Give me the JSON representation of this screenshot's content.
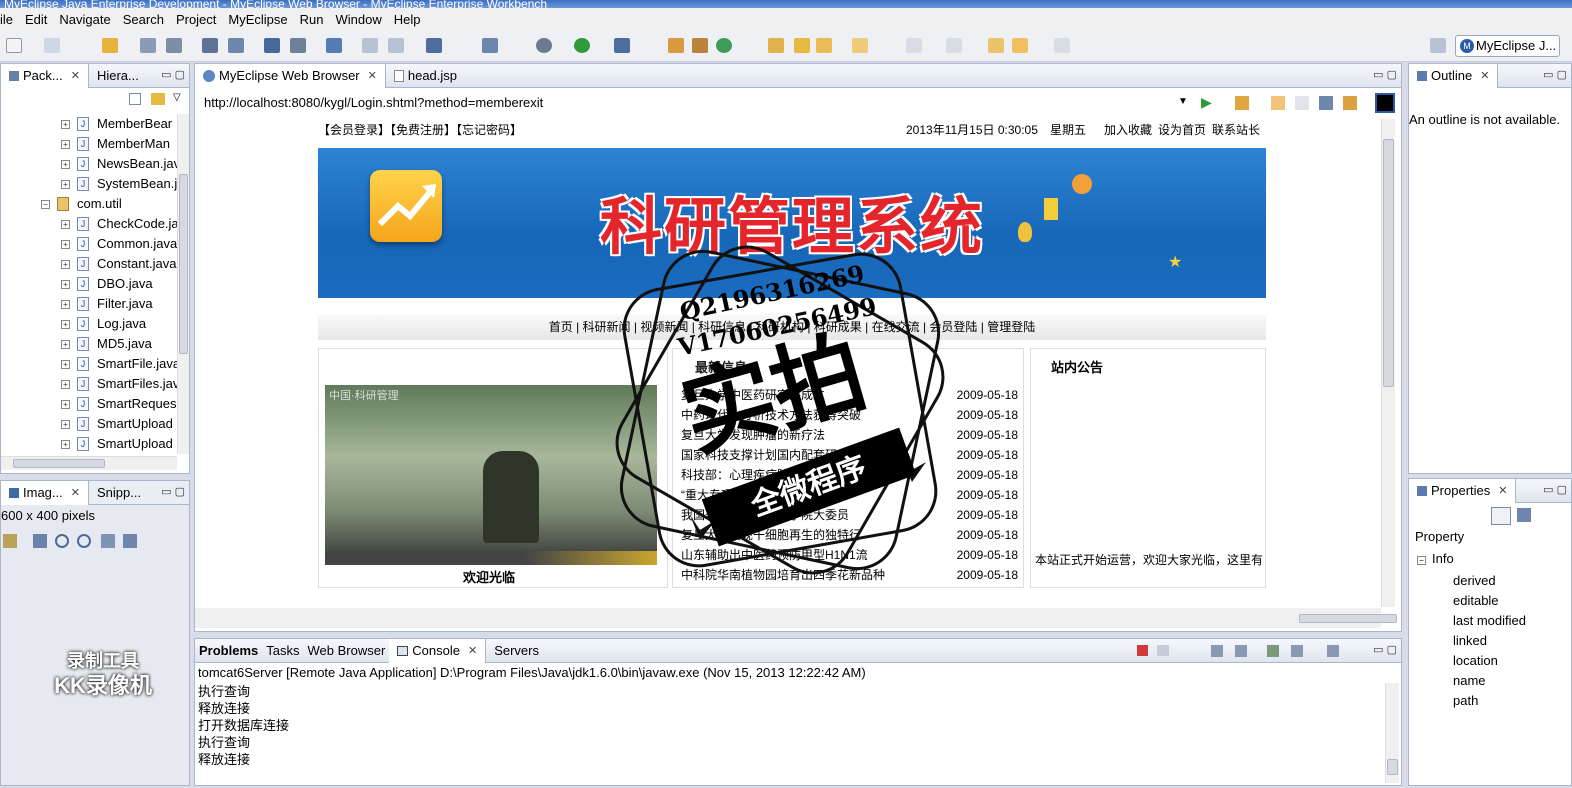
{
  "window": {
    "title": "MyEclipse Java Enterprise Development - MyEclipse Web Browser - MyEclipse Enterprise Workbench"
  },
  "menu": [
    "ile",
    "Edit",
    "Navigate",
    "Search",
    "Project",
    "MyEclipse",
    "Run",
    "Window",
    "Help"
  ],
  "perspective": "MyEclipse J...",
  "left_panel": {
    "tabs": [
      "Pack...",
      "Hiera..."
    ],
    "tree": [
      {
        "label": "MemberBear",
        "type": "java",
        "indent": 1
      },
      {
        "label": "MemberMan",
        "type": "java",
        "indent": 1
      },
      {
        "label": "NewsBean.jav",
        "type": "java",
        "indent": 1
      },
      {
        "label": "SystemBean.j",
        "type": "java",
        "indent": 1
      },
      {
        "label": "com.util",
        "type": "package",
        "indent": 0
      },
      {
        "label": "CheckCode.ja",
        "type": "java",
        "indent": 1
      },
      {
        "label": "Common.java",
        "type": "java",
        "indent": 1
      },
      {
        "label": "Constant.java",
        "type": "java",
        "indent": 1
      },
      {
        "label": "DBO.java",
        "type": "java",
        "indent": 1
      },
      {
        "label": "Filter.java",
        "type": "java",
        "indent": 1
      },
      {
        "label": "Log.java",
        "type": "java",
        "indent": 1
      },
      {
        "label": "MD5.java",
        "type": "java",
        "indent": 1
      },
      {
        "label": "SmartFile.java",
        "type": "java",
        "indent": 1
      },
      {
        "label": "SmartFiles.jav",
        "type": "java",
        "indent": 1
      },
      {
        "label": "SmartReques",
        "type": "java",
        "indent": 1
      },
      {
        "label": "SmartUpload",
        "type": "java",
        "indent": 1
      },
      {
        "label": "SmartUpload",
        "type": "java",
        "indent": 1
      }
    ]
  },
  "image_panel": {
    "tabs": [
      "Imag...",
      "Snipp..."
    ],
    "size_text": "600 x 400 pixels"
  },
  "editor": {
    "tabs": [
      "MyEclipse Web Browser",
      "head.jsp"
    ],
    "url": "http://localhost:8080/kygl/Login.shtml?method=memberexit"
  },
  "site": {
    "top_links": "【会员登录】【免费注册】【忘记密码】",
    "datetime": "2013年11月15日 0:30:05",
    "weekday": "星期五",
    "right_links": [
      "加入收藏",
      "设为首页",
      "联系站长"
    ],
    "banner_title": "科研管理系统",
    "nav": [
      "首页",
      "科研新闻",
      "视频新闻",
      "科研信息",
      "科研机构",
      "科研成果",
      "在线交流",
      "会员登陆",
      "管理登陆"
    ],
    "video_caption": "欢迎光临",
    "video_overlay_text": "中国·科研管理",
    "latest_title": "最新信息",
    "latest_items": [
      {
        "title": "复旦大学中医药研究院成立",
        "date": "2009-05-18"
      },
      {
        "title": "中药现代化分析技术方法获得突破",
        "date": "2009-05-18"
      },
      {
        "title": "复旦大学发现肿瘤的新疗法",
        "date": "2009-05-18"
      },
      {
        "title": "国家科技支撑计划国内配套研究",
        "date": "2009-05-18"
      },
      {
        "title": "科技部：心理疾病防治研究",
        "date": "2009-05-18"
      },
      {
        "title": "“重大专项”项目启动",
        "date": "2009-05-18"
      },
      {
        "title": "我国著名学者当选科学院大委员",
        "date": "2009-05-18"
      },
      {
        "title": "复旦大学发现干细胞再生的独特行",
        "date": "2009-05-18"
      },
      {
        "title": "山东辅助出中医药预防甲型H1N1流",
        "date": "2009-05-18"
      },
      {
        "title": "中科院华南植物园培育出四季花新品种",
        "date": "2009-05-18"
      }
    ],
    "notice_title": "站内公告",
    "notice_text": "本站正式开始运营，欢迎大家光临，这里有"
  },
  "watermark": {
    "qq": "Q2196316269",
    "v": "V17060256499",
    "big": "实拍",
    "banner": "全微程序"
  },
  "recorder_logo": [
    "录制工具",
    "KK录像机"
  ],
  "outline": {
    "tab": "Outline",
    "message": "An outline is not available."
  },
  "properties": {
    "tab": "Properties",
    "header": "Property",
    "group": "Info",
    "rows": [
      "derived",
      "editable",
      "last modified",
      "linked",
      "location",
      "name",
      "path"
    ]
  },
  "console": {
    "tabs": [
      "Problems",
      "Tasks",
      "Web Browser",
      "Console",
      "Servers"
    ],
    "header": "tomcat6Server [Remote Java Application] D:\\Program Files\\Java\\jdk1.6.0\\bin\\javaw.exe (Nov 15, 2013 12:22:42 AM)",
    "lines": [
      "执行查询",
      "释放连接",
      "打开数据库连接",
      "执行查询",
      "释放连接"
    ]
  },
  "colors": {
    "banner_blue": "#1b74c9",
    "banner_title_red": "#e4262c",
    "workbench_bg": "#d7dce8",
    "panel_border": "#a9b6cc"
  }
}
